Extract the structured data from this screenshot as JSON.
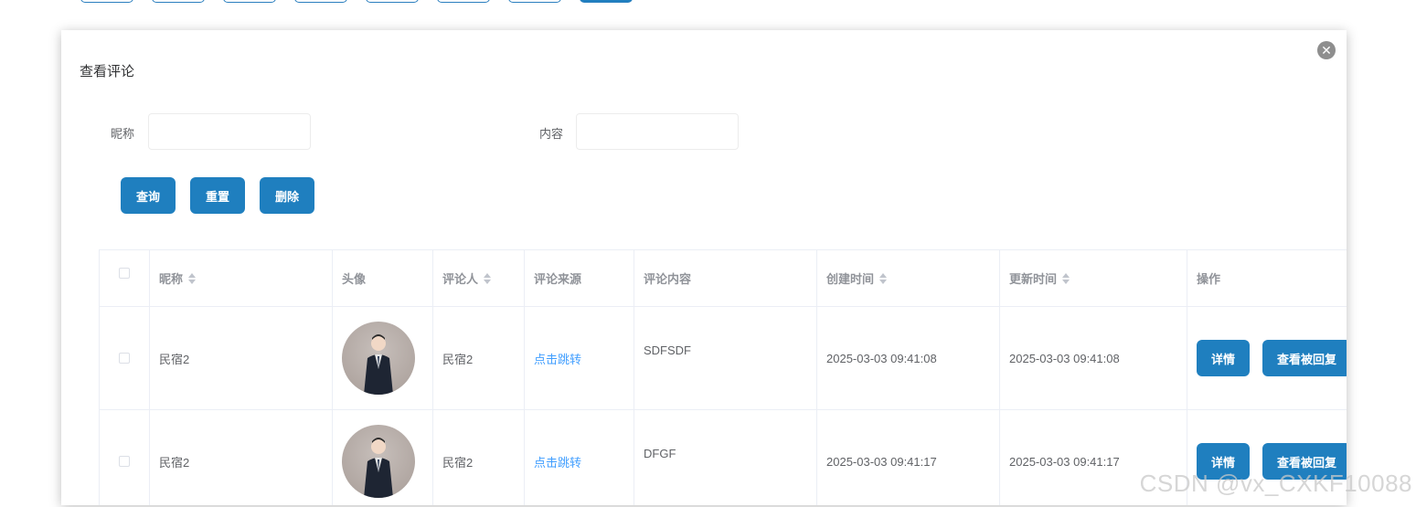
{
  "dialog": {
    "title": "查看评论",
    "close_icon": "close-icon"
  },
  "search": {
    "nickname_label": "昵称",
    "nickname_value": "",
    "content_label": "内容",
    "content_value": ""
  },
  "actions": {
    "query_label": "查询",
    "reset_label": "重置",
    "delete_label": "删除"
  },
  "table": {
    "headers": {
      "nickname": "昵称",
      "avatar": "头像",
      "commenter": "评论人",
      "source": "评论来源",
      "content": "评论内容",
      "created": "创建时间",
      "updated": "更新时间",
      "operation": "操作"
    },
    "rows": [
      {
        "nickname": "民宿2",
        "commenter": "民宿2",
        "source": "点击跳转",
        "content": "SDFSDF",
        "created": "2025-03-03 09:41:08",
        "updated": "2025-03-03 09:41:08",
        "detail_label": "详情",
        "replies_label": "查看被回复"
      },
      {
        "nickname": "民宿2",
        "commenter": "民宿2",
        "source": "点击跳转",
        "content": "DFGF",
        "created": "2025-03-03 09:41:17",
        "updated": "2025-03-03 09:41:17",
        "detail_label": "详情",
        "replies_label": "查看被回复"
      }
    ]
  },
  "watermark": "CSDN @vx_CXKF10088",
  "colors": {
    "primary": "#1f7fbf",
    "link": "#409eff",
    "border": "#ebeef5"
  }
}
